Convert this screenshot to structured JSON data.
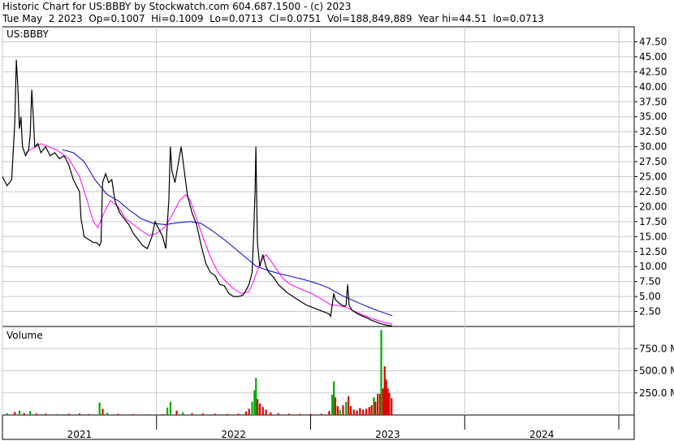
{
  "header": {
    "line1": "Historic Chart for US:BBBY by Stockwatch.com 604.687.1500 - (c) 2023",
    "line2": "Tue May  2 2023  Op=0.1007  Hi=0.1009  Lo=0.0713  Cl=0.0751  Vol=188,849,889  Year hi=44.51  lo=0.0713"
  },
  "price_panel": {
    "label": "US:BBBY"
  },
  "volume_panel": {
    "label": "Volume"
  },
  "colors": {
    "price": "#000000",
    "ma_short": "#ff00ff",
    "ma_long": "#0000cc",
    "vol_up": "#00aa00",
    "vol_down": "#dd0000",
    "grid": "#c8c8c8"
  },
  "chart_data": {
    "type": "line",
    "title": "Historic Chart for US:BBBY",
    "y_axis": {
      "range": [
        0,
        50
      ],
      "ticks": [
        "47.50",
        "45.00",
        "42.50",
        "40.00",
        "37.50",
        "35.00",
        "32.50",
        "30.00",
        "27.50",
        "25.00",
        "22.50",
        "20.00",
        "17.50",
        "15.00",
        "12.50",
        "10.00",
        "7.50",
        "5.00",
        "2.50"
      ],
      "tick_values": [
        47.5,
        45,
        42.5,
        40,
        37.5,
        35,
        32.5,
        30,
        27.5,
        25,
        22.5,
        20,
        17.5,
        15,
        12.5,
        10,
        7.5,
        5,
        2.5
      ]
    },
    "x_axis": {
      "labels": [
        "2021",
        "2022",
        "2023",
        "2024"
      ],
      "domain": [
        0,
        41
      ]
    },
    "volume_axis": {
      "range": [
        0,
        1000
      ],
      "ticks": [
        "750.0 M",
        "500.0 M",
        "250.0 M"
      ],
      "tick_values": [
        750,
        500,
        250
      ]
    },
    "grid": true,
    "price": [
      [
        0,
        25
      ],
      [
        0.3,
        23.5
      ],
      [
        0.6,
        24.5
      ],
      [
        0.8,
        34
      ],
      [
        0.9,
        44.5
      ],
      [
        1.0,
        40
      ],
      [
        1.1,
        33
      ],
      [
        1.2,
        35
      ],
      [
        1.3,
        30
      ],
      [
        1.5,
        28.5
      ],
      [
        1.7,
        29.5
      ],
      [
        1.8,
        32
      ],
      [
        1.9,
        39.5
      ],
      [
        2.0,
        35
      ],
      [
        2.1,
        30
      ],
      [
        2.3,
        30.5
      ],
      [
        2.5,
        29
      ],
      [
        2.8,
        30
      ],
      [
        3.1,
        28.5
      ],
      [
        3.4,
        29
      ],
      [
        3.7,
        28
      ],
      [
        4.0,
        28.5
      ],
      [
        4.3,
        27
      ],
      [
        4.6,
        24.5
      ],
      [
        4.9,
        23
      ],
      [
        5.0,
        22.5
      ],
      [
        5.1,
        18
      ],
      [
        5.3,
        15
      ],
      [
        5.6,
        14.5
      ],
      [
        5.9,
        14
      ],
      [
        6.1,
        14
      ],
      [
        6.3,
        13.5
      ],
      [
        6.4,
        14
      ],
      [
        6.5,
        24
      ],
      [
        6.7,
        25.5
      ],
      [
        6.9,
        24
      ],
      [
        7.1,
        24.5
      ],
      [
        7.3,
        21
      ],
      [
        7.6,
        19
      ],
      [
        7.9,
        18
      ],
      [
        8.2,
        17
      ],
      [
        8.5,
        15.5
      ],
      [
        8.8,
        14.5
      ],
      [
        9.1,
        13.5
      ],
      [
        9.4,
        13
      ],
      [
        9.7,
        15
      ],
      [
        9.9,
        17.5
      ],
      [
        10.1,
        16.5
      ],
      [
        10.4,
        15
      ],
      [
        10.6,
        13
      ],
      [
        10.8,
        21
      ],
      [
        10.9,
        30
      ],
      [
        11.0,
        26
      ],
      [
        11.2,
        24
      ],
      [
        11.4,
        27
      ],
      [
        11.6,
        30
      ],
      [
        11.8,
        26
      ],
      [
        12.0,
        22
      ],
      [
        12.3,
        19
      ],
      [
        12.6,
        17
      ],
      [
        12.9,
        13.5
      ],
      [
        13.2,
        10.5
      ],
      [
        13.5,
        9
      ],
      [
        13.8,
        8.5
      ],
      [
        14.1,
        7
      ],
      [
        14.4,
        6.8
      ],
      [
        14.7,
        5.5
      ],
      [
        15.0,
        5
      ],
      [
        15.3,
        5
      ],
      [
        15.6,
        5.2
      ],
      [
        15.8,
        6
      ],
      [
        16.0,
        7
      ],
      [
        16.2,
        9
      ],
      [
        16.3,
        15
      ],
      [
        16.4,
        23
      ],
      [
        16.45,
        30
      ],
      [
        16.55,
        14
      ],
      [
        16.7,
        10
      ],
      [
        16.9,
        12
      ],
      [
        17.1,
        10
      ],
      [
        17.3,
        9
      ],
      [
        17.6,
        8.2
      ],
      [
        17.9,
        7
      ],
      [
        18.2,
        6.3
      ],
      [
        18.5,
        5.6
      ],
      [
        18.8,
        5.1
      ],
      [
        19.1,
        4.6
      ],
      [
        19.4,
        4.1
      ],
      [
        19.7,
        3.6
      ],
      [
        20.0,
        3.3
      ],
      [
        20.3,
        3
      ],
      [
        20.6,
        2.7
      ],
      [
        20.9,
        2.4
      ],
      [
        21.2,
        2.1
      ],
      [
        21.3,
        1.7
      ],
      [
        21.5,
        5.5
      ],
      [
        21.6,
        4.5
      ],
      [
        21.8,
        4
      ],
      [
        22.0,
        3.6
      ],
      [
        22.2,
        3.4
      ],
      [
        22.3,
        3.5
      ],
      [
        22.4,
        7
      ],
      [
        22.5,
        3.5
      ],
      [
        22.7,
        2.7
      ],
      [
        23.0,
        2.2
      ],
      [
        23.3,
        1.8
      ],
      [
        23.6,
        1.5
      ],
      [
        23.9,
        1.1
      ],
      [
        24.2,
        0.8
      ],
      [
        24.5,
        0.5
      ],
      [
        24.8,
        0.3
      ],
      [
        25.1,
        0.15
      ],
      [
        25.3,
        0.08
      ]
    ],
    "ma_short": [
      [
        1.5,
        29
      ],
      [
        2.5,
        30.5
      ],
      [
        3.5,
        29.5
      ],
      [
        4.3,
        28
      ],
      [
        5.0,
        25
      ],
      [
        5.5,
        21
      ],
      [
        5.9,
        17.5
      ],
      [
        6.2,
        16.5
      ],
      [
        6.6,
        19
      ],
      [
        7.0,
        21
      ],
      [
        7.5,
        20
      ],
      [
        8.0,
        18
      ],
      [
        8.5,
        17
      ],
      [
        9.0,
        16
      ],
      [
        9.5,
        15.2
      ],
      [
        10.0,
        15.5
      ],
      [
        10.5,
        16.5
      ],
      [
        11.0,
        18.5
      ],
      [
        11.5,
        21
      ],
      [
        11.9,
        22
      ],
      [
        12.2,
        21
      ],
      [
        12.6,
        18
      ],
      [
        13.0,
        15
      ],
      [
        13.5,
        11.5
      ],
      [
        14.0,
        9
      ],
      [
        14.5,
        7.5
      ],
      [
        15.0,
        6.3
      ],
      [
        15.5,
        5.5
      ],
      [
        16.0,
        5.8
      ],
      [
        16.3,
        7.5
      ],
      [
        16.7,
        10.5
      ],
      [
        17.1,
        12
      ],
      [
        17.4,
        11
      ],
      [
        17.8,
        9.5
      ],
      [
        18.2,
        8
      ],
      [
        18.7,
        7
      ],
      [
        19.3,
        6.3
      ],
      [
        20.0,
        5.6
      ],
      [
        20.7,
        4.6
      ],
      [
        21.3,
        3.6
      ],
      [
        21.8,
        3.5
      ],
      [
        22.3,
        3.2
      ],
      [
        22.8,
        2.6
      ],
      [
        23.4,
        1.9
      ],
      [
        24.0,
        1.3
      ],
      [
        24.6,
        0.8
      ],
      [
        25.3,
        0.4
      ]
    ],
    "ma_long": [
      [
        3.9,
        29.5
      ],
      [
        4.6,
        29
      ],
      [
        5.3,
        27.5
      ],
      [
        6.0,
        24.5
      ],
      [
        6.8,
        22
      ],
      [
        7.5,
        21
      ],
      [
        8.2,
        19.5
      ],
      [
        9.0,
        18
      ],
      [
        9.8,
        17.2
      ],
      [
        10.6,
        17
      ],
      [
        11.4,
        17.3
      ],
      [
        12.2,
        17.5
      ],
      [
        12.9,
        17.2
      ],
      [
        13.6,
        16
      ],
      [
        14.4,
        14.5
      ],
      [
        15.1,
        13
      ],
      [
        15.8,
        11.5
      ],
      [
        16.5,
        10
      ],
      [
        17.3,
        9.3
      ],
      [
        18.0,
        8.8
      ],
      [
        18.8,
        8.3
      ],
      [
        19.6,
        7.8
      ],
      [
        20.4,
        7.2
      ],
      [
        21.2,
        6.4
      ],
      [
        22.0,
        5.2
      ],
      [
        22.8,
        4.3
      ],
      [
        23.6,
        3.4
      ],
      [
        24.4,
        2.6
      ],
      [
        25.3,
        1.8
      ]
    ],
    "volume": [
      [
        0.3,
        20,
        "up"
      ],
      [
        0.8,
        35,
        "down"
      ],
      [
        1.1,
        50,
        "up"
      ],
      [
        1.4,
        22,
        "down"
      ],
      [
        1.8,
        45,
        "up"
      ],
      [
        2.2,
        18,
        "down"
      ],
      [
        2.8,
        15,
        "down"
      ],
      [
        3.5,
        12,
        "up"
      ],
      [
        4.3,
        14,
        "down"
      ],
      [
        5.0,
        18,
        "down"
      ],
      [
        5.6,
        12,
        "down"
      ],
      [
        6.3,
        140,
        "up"
      ],
      [
        6.5,
        70,
        "down"
      ],
      [
        6.8,
        25,
        "up"
      ],
      [
        7.5,
        14,
        "down"
      ],
      [
        8.5,
        12,
        "down"
      ],
      [
        9.5,
        10,
        "up"
      ],
      [
        10.4,
        10,
        "down"
      ],
      [
        10.7,
        85,
        "up"
      ],
      [
        10.9,
        150,
        "up"
      ],
      [
        11.3,
        50,
        "down"
      ],
      [
        11.7,
        30,
        "up"
      ],
      [
        12.3,
        20,
        "down"
      ],
      [
        13.0,
        18,
        "down"
      ],
      [
        13.8,
        14,
        "down"
      ],
      [
        14.6,
        12,
        "down"
      ],
      [
        15.3,
        15,
        "down"
      ],
      [
        15.8,
        40,
        "down"
      ],
      [
        16.0,
        70,
        "down"
      ],
      [
        16.2,
        150,
        "up"
      ],
      [
        16.35,
        280,
        "up"
      ],
      [
        16.45,
        420,
        "up"
      ],
      [
        16.55,
        180,
        "down"
      ],
      [
        16.7,
        130,
        "down"
      ],
      [
        16.9,
        90,
        "down"
      ],
      [
        17.1,
        60,
        "down"
      ],
      [
        17.4,
        30,
        "down"
      ],
      [
        17.9,
        20,
        "down"
      ],
      [
        18.6,
        15,
        "down"
      ],
      [
        19.3,
        12,
        "down"
      ],
      [
        20.0,
        12,
        "down"
      ],
      [
        20.7,
        15,
        "down"
      ],
      [
        21.2,
        45,
        "down"
      ],
      [
        21.4,
        230,
        "up"
      ],
      [
        21.5,
        380,
        "up"
      ],
      [
        21.6,
        200,
        "down"
      ],
      [
        21.75,
        100,
        "down"
      ],
      [
        21.9,
        60,
        "up"
      ],
      [
        22.1,
        110,
        "down"
      ],
      [
        22.3,
        150,
        "up"
      ],
      [
        22.45,
        210,
        "down"
      ],
      [
        22.6,
        100,
        "down"
      ],
      [
        22.8,
        60,
        "down"
      ],
      [
        23.0,
        50,
        "down"
      ],
      [
        23.2,
        80,
        "down"
      ],
      [
        23.4,
        60,
        "down"
      ],
      [
        23.6,
        70,
        "down"
      ],
      [
        23.8,
        90,
        "down"
      ],
      [
        23.95,
        110,
        "down"
      ],
      [
        24.1,
        200,
        "up"
      ],
      [
        24.2,
        150,
        "down"
      ],
      [
        24.35,
        240,
        "down"
      ],
      [
        24.5,
        240,
        "down"
      ],
      [
        24.58,
        960,
        "up"
      ],
      [
        24.7,
        300,
        "down"
      ],
      [
        24.8,
        550,
        "down"
      ],
      [
        24.9,
        400,
        "down"
      ],
      [
        25.0,
        300,
        "down"
      ],
      [
        25.1,
        250,
        "down"
      ],
      [
        25.25,
        190,
        "down"
      ]
    ]
  }
}
